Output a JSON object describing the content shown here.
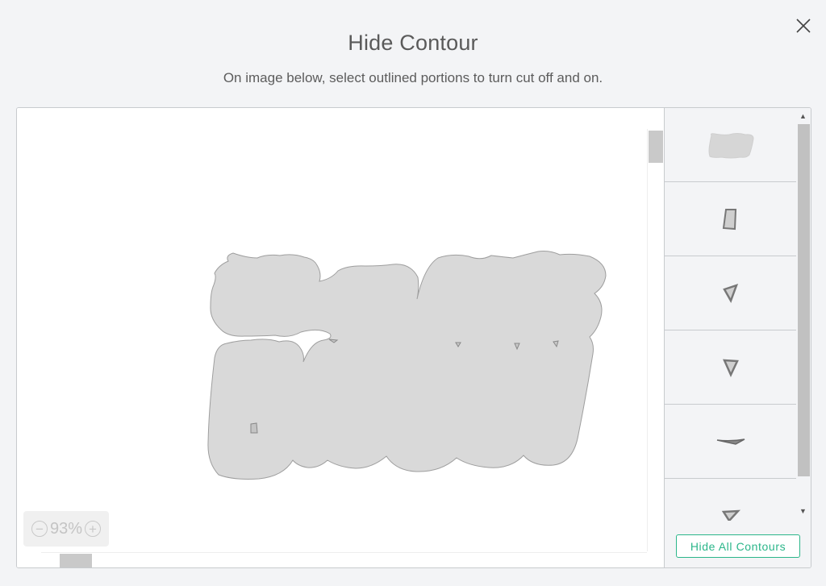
{
  "dialog": {
    "title": "Hide Contour",
    "subtitle": "On image below, select outlined portions to turn cut off and on."
  },
  "canvas": {
    "zoom_value": "93%",
    "zoom_out_label": "−",
    "zoom_in_label": "+",
    "contour_fill": "#d9d9d9",
    "contour_stroke": "#9e9e9e"
  },
  "sidebar": {
    "tiles": [
      {
        "name": "contour-main-word"
      },
      {
        "name": "contour-quad-hole"
      },
      {
        "name": "contour-triangle-hole-1"
      },
      {
        "name": "contour-triangle-hole-2"
      },
      {
        "name": "contour-sliver-hole"
      },
      {
        "name": "contour-triangle-hole-3"
      }
    ],
    "scroll_up_label": "▲",
    "scroll_down_label": "▼",
    "hide_all_label": "Hide All Contours"
  },
  "colors": {
    "accent": "#2bb68a",
    "background": "#f3f4f6"
  },
  "icons": {
    "close": "close-icon",
    "zoom_out": "minus-circle-icon",
    "zoom_in": "plus-circle-icon"
  }
}
